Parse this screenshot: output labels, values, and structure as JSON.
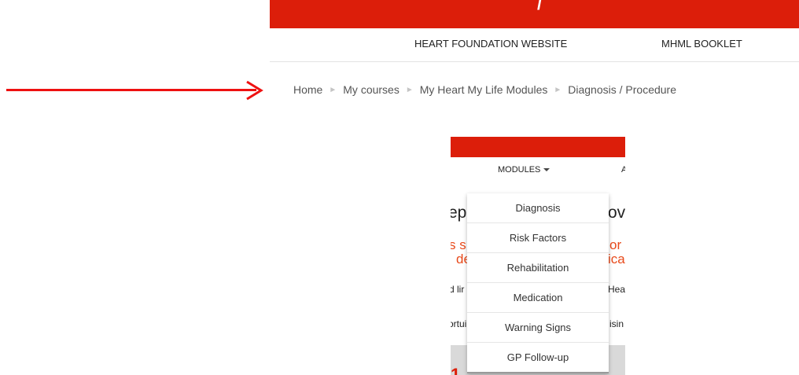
{
  "header": {
    "glyph": "/",
    "links": [
      {
        "label": "HEART FOUNDATION WEBSITE"
      },
      {
        "label": "MHML BOOKLET"
      }
    ]
  },
  "breadcrumb": {
    "separator": "►",
    "items": [
      {
        "label": "Home"
      },
      {
        "label": "My courses"
      },
      {
        "label": "My Heart My Life Modules"
      },
      {
        "label": "Diagnosis / Procedure"
      }
    ]
  },
  "inset": {
    "nav": {
      "modules_label": "MODULES",
      "clipped_next": "A"
    },
    "fragments": {
      "heading_left": "ep",
      "heading_right": "ov",
      "orange_line1_left": "s s",
      "orange_line1_right": "or",
      "orange_line2_left": "de",
      "orange_line2_right": "ica",
      "body1_left": "d lir",
      "body1_right": "Hea",
      "body2_left": "ortui",
      "body2_right": "isin",
      "digit": "1"
    }
  },
  "dropdown": {
    "items": [
      {
        "label": "Diagnosis"
      },
      {
        "label": "Risk Factors"
      },
      {
        "label": "Rehabilitation"
      },
      {
        "label": "Medication"
      },
      {
        "label": "Warning Signs"
      },
      {
        "label": "GP Follow-up"
      }
    ]
  },
  "colors": {
    "brand_red": "#dc1e0a",
    "accent_orange": "#e84a1b",
    "arrow_red": "#ee1111"
  }
}
